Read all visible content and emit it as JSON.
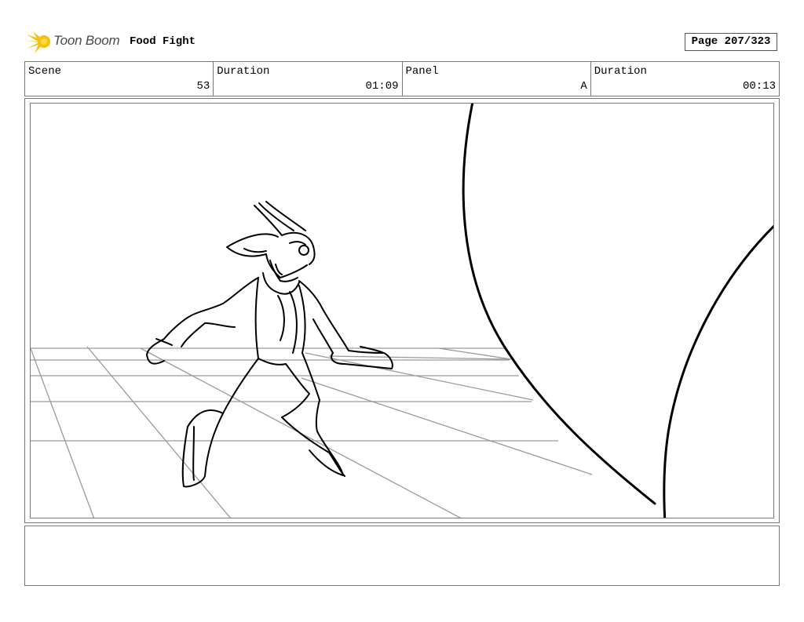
{
  "header": {
    "logo_text": "Toon Boom",
    "project_title": "Food Fight",
    "page_label": "Page 207/323"
  },
  "info": {
    "scene": {
      "label": "Scene",
      "value": "53"
    },
    "scene_duration": {
      "label": "Duration",
      "value": "01:09"
    },
    "panel": {
      "label": "Panel",
      "value": "A"
    },
    "panel_duration": {
      "label": "Duration",
      "value": "00:13"
    }
  },
  "colors": {
    "logo_accent": "#f2c20f",
    "frame_border": "#777777",
    "sketch_line": "#000000",
    "guide_line": "#9a9a9a"
  },
  "notes": {
    "text": ""
  }
}
